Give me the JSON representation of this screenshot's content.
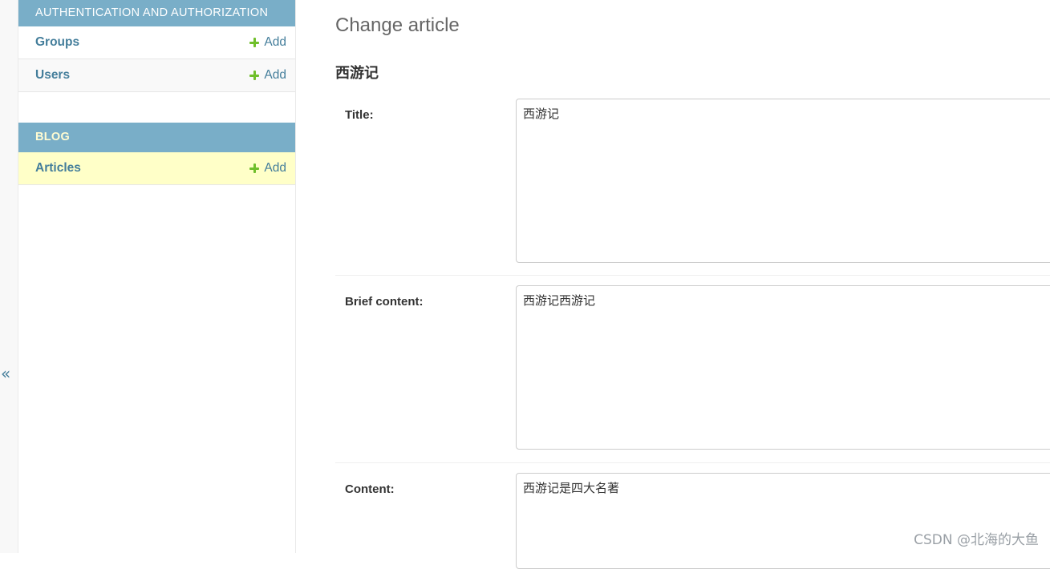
{
  "sidebar": {
    "toggle_glyph": "«",
    "modules": [
      {
        "caption": "AUTHENTICATION AND AUTHORIZATION",
        "models": [
          {
            "name": "Groups",
            "add_label": "Add"
          },
          {
            "name": "Users",
            "add_label": "Add"
          }
        ]
      },
      {
        "caption": "BLOG",
        "models": [
          {
            "name": "Articles",
            "add_label": "Add"
          }
        ]
      }
    ]
  },
  "main": {
    "page_title": "Change article",
    "object_title": "西游记",
    "fields": [
      {
        "label": "Title:",
        "value": "西游记"
      },
      {
        "label": "Brief content:",
        "value": "西游记西游记"
      },
      {
        "label": "Content:",
        "value": "西游记是四大名著"
      }
    ]
  },
  "watermark": "CSDN @北海的大鱼",
  "colors": {
    "module_caption_bg": "#79aec8",
    "link": "#447e9b",
    "add_icon": "#70bf2b",
    "current_row_bg": "#ffffc8",
    "blog_caption_text": "#fffcd2"
  }
}
